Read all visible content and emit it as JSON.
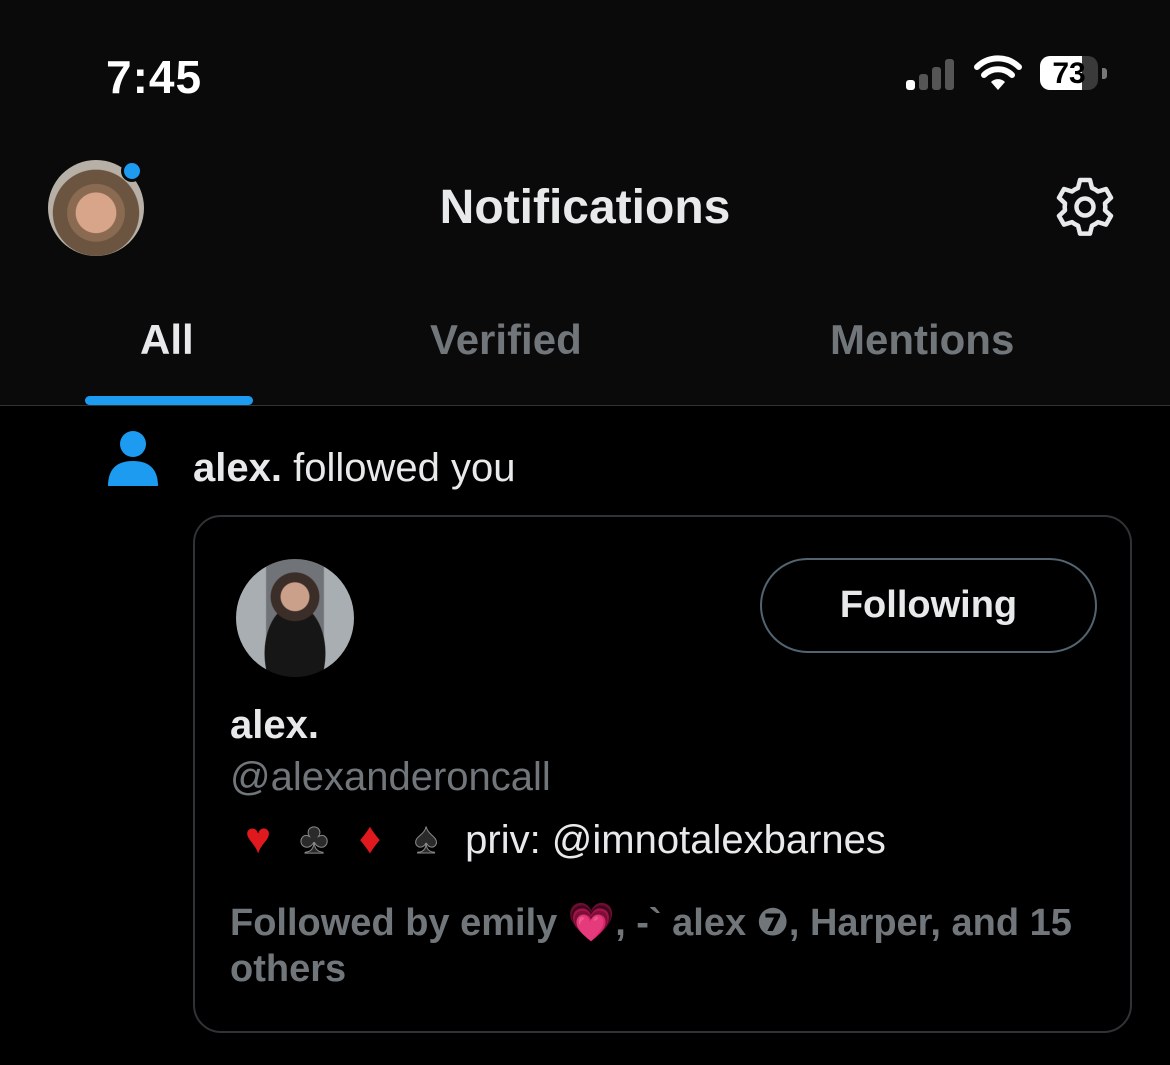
{
  "status_bar": {
    "time": "7:45",
    "battery": "73",
    "battery_level": 0.73
  },
  "header": {
    "title": "Notifications"
  },
  "tabs": [
    {
      "label": "All",
      "active": true
    },
    {
      "label": "Verified",
      "active": false
    },
    {
      "label": "Mentions",
      "active": false
    }
  ],
  "notification": {
    "actor": "alex.",
    "action": "followed you",
    "card": {
      "name": "alex.",
      "handle": "@alexanderoncall",
      "bio_suits": [
        "♥",
        "♣",
        "♦",
        "♠"
      ],
      "bio_text": "priv: @imnotalexbarnes",
      "follow_button": "Following",
      "followed_by_prefix": "Followed by emily",
      "followed_by_heart": "💗",
      "followed_by_rest": ", -` alex ❼, Harper, and 15 others"
    }
  },
  "colors": {
    "accent": "#1d9bf0",
    "background": "#000000",
    "secondary_text": "#71767b"
  }
}
